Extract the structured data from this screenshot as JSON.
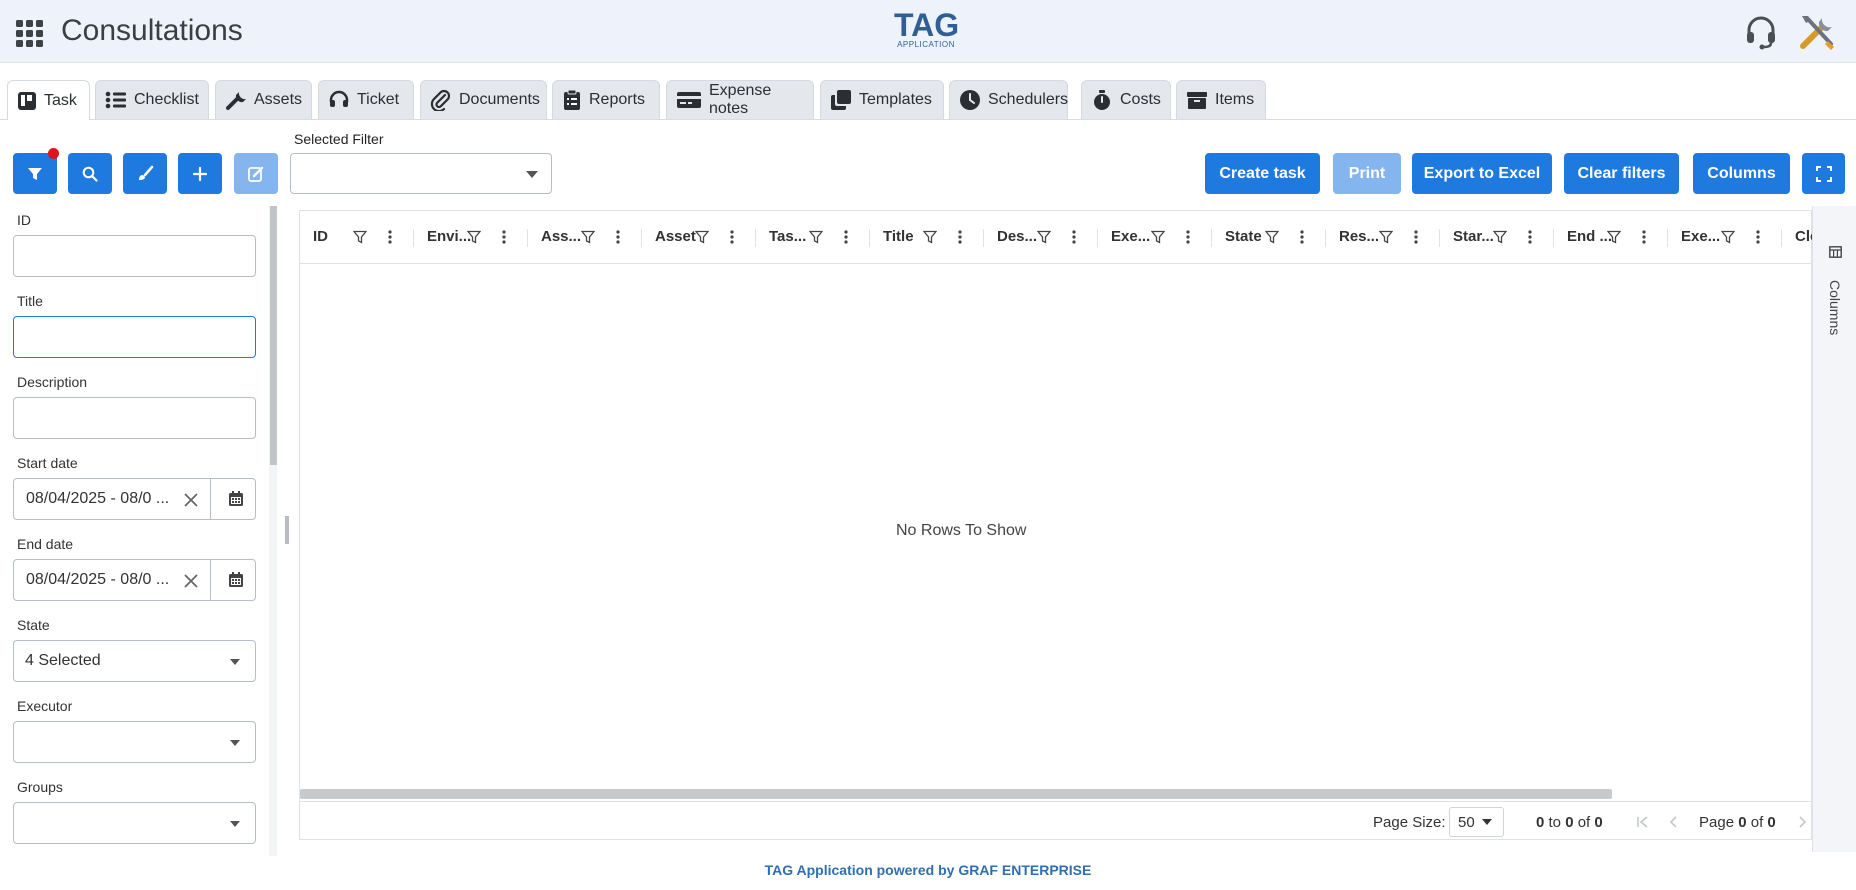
{
  "header": {
    "title": "Consultations",
    "logo_main": "TAG",
    "logo_sub": "APPLICATION"
  },
  "tabs": [
    {
      "label": "Task",
      "icon": "kanban-icon"
    },
    {
      "label": "Checklist",
      "icon": "list-icon"
    },
    {
      "label": "Assets",
      "icon": "wrench-icon"
    },
    {
      "label": "Ticket",
      "icon": "headset-icon"
    },
    {
      "label": "Documents",
      "icon": "paperclip-icon"
    },
    {
      "label": "Reports",
      "icon": "clipboard-icon"
    },
    {
      "label": "Expense notes",
      "icon": "credit-card-icon"
    },
    {
      "label": "Templates",
      "icon": "copy-icon"
    },
    {
      "label": "Schedulers",
      "icon": "clock-icon"
    },
    {
      "label": "Costs",
      "icon": "stopwatch-icon"
    },
    {
      "label": "Items",
      "icon": "box-icon"
    }
  ],
  "toolbar": {
    "selected_filter_label": "Selected Filter",
    "selected_filter_value": "",
    "create_task": "Create task",
    "print": "Print",
    "export_excel": "Export to Excel",
    "clear_filters": "Clear filters",
    "columns": "Columns"
  },
  "filters": {
    "id": {
      "label": "ID",
      "value": ""
    },
    "title": {
      "label": "Title",
      "value": ""
    },
    "description": {
      "label": "Description",
      "value": ""
    },
    "start_date": {
      "label": "Start date",
      "value": "08/04/2025 - 08/0 ..."
    },
    "end_date": {
      "label": "End date",
      "value": "08/04/2025 - 08/0 ..."
    },
    "state": {
      "label": "State",
      "value": "4 Selected"
    },
    "executor": {
      "label": "Executor",
      "value": ""
    },
    "groups": {
      "label": "Groups",
      "value": ""
    }
  },
  "grid": {
    "columns": [
      "ID",
      "Envi...",
      "Ass...",
      "Asset",
      "Tas...",
      "Title",
      "Des...",
      "Exe...",
      "State",
      "Res...",
      "Star...",
      "End ...",
      "Exe...",
      "Clos"
    ],
    "empty_message": "No Rows To Show",
    "side_panel_label": "Columns"
  },
  "paging": {
    "page_size_label": "Page Size:",
    "page_size": "50",
    "row_from": "0",
    "row_to_word": "to",
    "row_to": "0",
    "of_word": "of",
    "row_total": "0",
    "page_word": "Page",
    "page_current": "0",
    "page_total": "0"
  },
  "footer": {
    "text": "TAG Application powered by GRAF ENTERPRISE"
  },
  "colors": {
    "primary": "#1f7ae0",
    "primary_disabled": "#84b5ee",
    "header_bg": "#eef3fb",
    "notification": "#e0121b",
    "footer_text": "#2f6fb0"
  }
}
